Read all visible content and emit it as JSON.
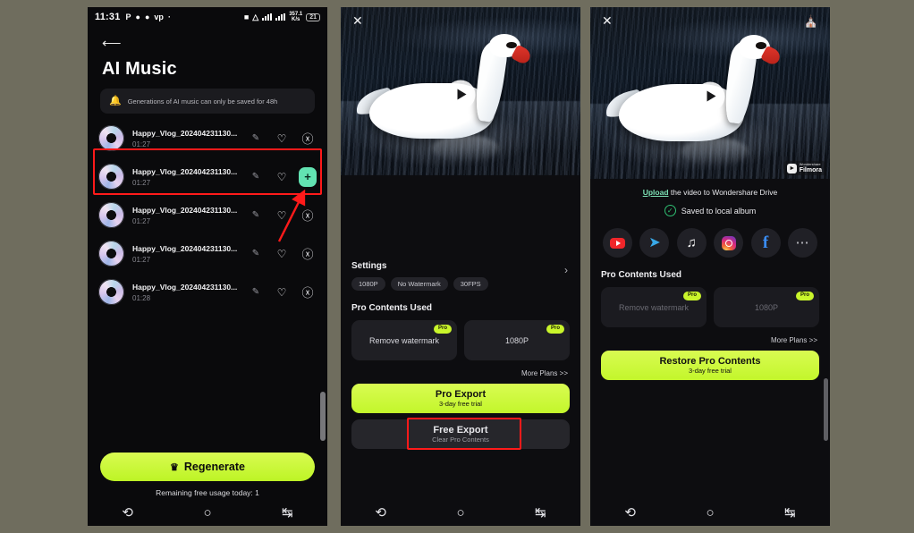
{
  "status_bar": {
    "time": "11:31",
    "left_icons": [
      "P",
      "message-icon",
      "snapchat-icon",
      "vp-icon",
      "dot-icon"
    ],
    "network_speed": "357.1",
    "network_speed_unit": "K/s",
    "battery": "21"
  },
  "phone1": {
    "back_icon": "back-arrow-icon",
    "title": "AI Music",
    "notice": "Generations of AI music can only be saved for 48h",
    "notice_icon": "bell-icon",
    "tracks": [
      {
        "name": "Happy_Vlog_202404231130...",
        "duration": "01:27",
        "action": "download",
        "highlighted": false
      },
      {
        "name": "Happy_Vlog_202404231130...",
        "duration": "01:27",
        "action": "add",
        "highlighted": true
      },
      {
        "name": "Happy_Vlog_202404231130...",
        "duration": "01:27",
        "action": "download",
        "highlighted": false
      },
      {
        "name": "Happy_Vlog_202404231130...",
        "duration": "01:27",
        "action": "download",
        "highlighted": false
      },
      {
        "name": "Happy_Vlog_202404231130...",
        "duration": "01:28",
        "action": "download",
        "highlighted": false
      }
    ],
    "regenerate_label": "Regenerate",
    "regenerate_icon": "crown-icon",
    "usage_text": "Remaining free usage today: 1"
  },
  "phone2": {
    "close_icon": "close-icon",
    "play_icon": "play-icon",
    "settings_title": "Settings",
    "settings_chevron": "chevron-right-icon",
    "setting_tags": [
      "1080P",
      "No Watermark",
      "30FPS"
    ],
    "pro_contents_title": "Pro Contents Used",
    "pro_cards": [
      {
        "label": "Remove watermark",
        "badge": "Pro"
      },
      {
        "label": "1080P",
        "badge": "Pro"
      }
    ],
    "more_plans": "More Plans >>",
    "pro_export": {
      "title": "Pro Export",
      "subtitle": "3-day free trial"
    },
    "free_export": {
      "title": "Free Export",
      "subtitle": "Clear Pro Contents"
    }
  },
  "phone3": {
    "close_icon": "close-icon",
    "home_icon": "home-icon",
    "play_icon": "play-icon",
    "watermark": {
      "brand_small": "Wondershare",
      "brand_main": "Filmora"
    },
    "upload_link": "Upload",
    "upload_rest": " the video to Wondershare Drive",
    "saved_text": "Saved to local album",
    "saved_icon": "check-circle-icon",
    "socials": [
      "youtube-icon",
      "telegram-icon",
      "tiktok-icon",
      "instagram-icon",
      "facebook-icon",
      "more-icon"
    ],
    "pro_contents_title": "Pro Contents Used",
    "pro_cards": [
      {
        "label": "Remove watermark",
        "badge": "Pro"
      },
      {
        "label": "1080P",
        "badge": "Pro"
      }
    ],
    "more_plans": "More Plans >>",
    "restore": {
      "title": "Restore Pro Contents",
      "subtitle": "3-day free trial"
    }
  },
  "nav_bar": {
    "icons": [
      "recents-icon",
      "home-icon",
      "back-icon"
    ]
  },
  "colors": {
    "lime": "#ccf93e",
    "mint": "#62e3b2",
    "annotation_red": "#ff1a1a",
    "background": "#6f6d5e",
    "panel": "#0a0a0c"
  }
}
